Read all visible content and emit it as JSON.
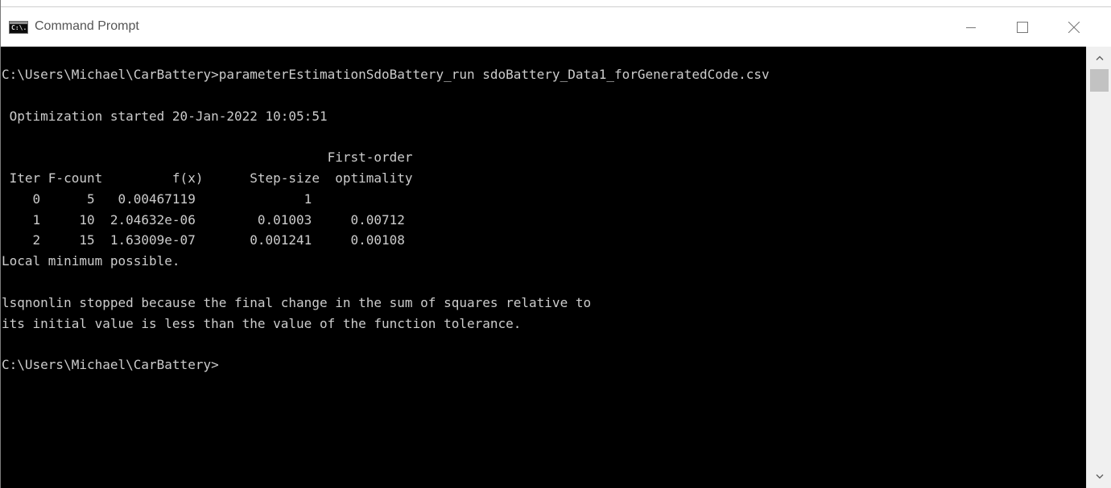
{
  "window": {
    "title": "Command Prompt",
    "icon": "cmd-icon",
    "icon_glyph": "C:\\."
  },
  "controls": {
    "minimize": "minimize-icon",
    "maximize": "maximize-icon",
    "close": "close-icon"
  },
  "console": {
    "lines": [
      "C:\\Users\\Michael\\CarBattery>parameterEstimationSdoBattery_run sdoBattery_Data1_forGeneratedCode.csv",
      "",
      " Optimization started 20-Jan-2022 10:05:51",
      "",
      "                                          First-order",
      " Iter F-count         f(x)      Step-size  optimality",
      "    0      5   0.00467119              1",
      "    1     10  2.04632e-06        0.01003     0.00712",
      "    2     15  1.63009e-07       0.001241     0.00108",
      "Local minimum possible.",
      "",
      "lsqnonlin stopped because the final change in the sum of squares relative to",
      "its initial value is less than the value of the function tolerance.",
      "",
      "C:\\Users\\Michael\\CarBattery>"
    ]
  },
  "scrollbar": {
    "up": "scroll-up-arrow-icon",
    "down": "scroll-down-arrow-icon"
  },
  "colors": {
    "console_background": "#000000",
    "console_text": "#cccccc",
    "titlebar_background": "#ffffff"
  }
}
